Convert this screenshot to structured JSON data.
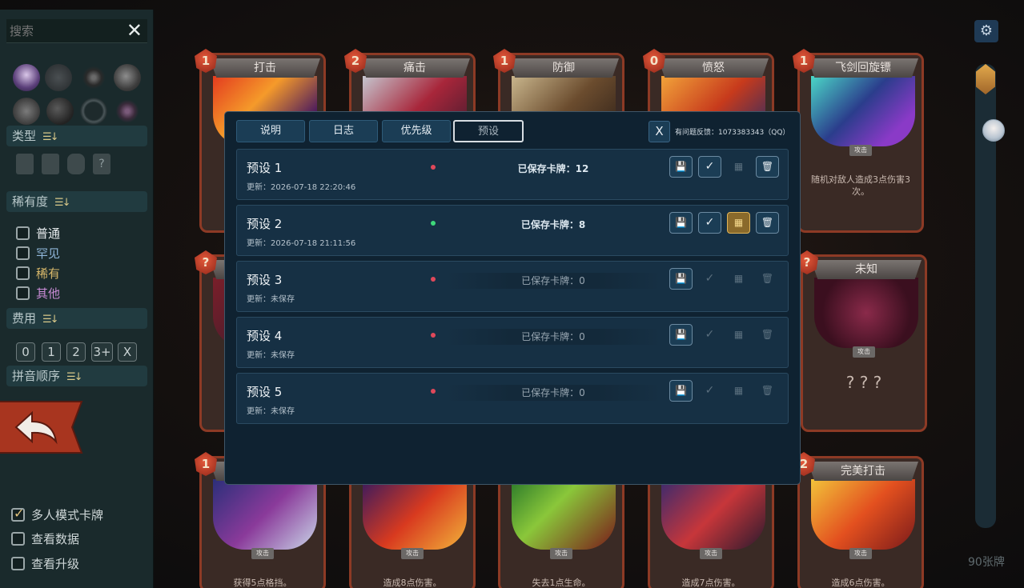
{
  "search": {
    "placeholder": "搜索",
    "close": "✕"
  },
  "filters": {
    "type_label": "类型",
    "type_icons": [
      "attack-card-type",
      "skill-card-type",
      "power-card-type",
      "unknown-card-type"
    ],
    "type_icon_glyphs": [
      "",
      "",
      "",
      "?"
    ],
    "rarity_label": "稀有度",
    "rarity_items": [
      {
        "label": "普通",
        "color": "#e8ecee"
      },
      {
        "label": "罕见",
        "color": "#8fb6d9"
      },
      {
        "label": "稀有",
        "color": "#d8b86a"
      },
      {
        "label": "其他",
        "color": "#c98cd6"
      }
    ],
    "cost_label": "费用",
    "cost_options": [
      "0",
      "1",
      "2",
      "3+",
      "X"
    ],
    "pinyin_label": "拼音顺序",
    "sort_glyph": "☰↓"
  },
  "bottom_options": [
    {
      "label": "多人模式卡牌",
      "checked": true
    },
    {
      "label": "查看数据",
      "checked": false
    },
    {
      "label": "查看升级",
      "checked": false
    }
  ],
  "settings_glyph": "⚙",
  "card_count": "90张牌",
  "cards": [
    {
      "name": "打击",
      "cost": "1",
      "type": "",
      "desc": ""
    },
    {
      "name": "痛击",
      "cost": "2",
      "type": "",
      "desc": ""
    },
    {
      "name": "防御",
      "cost": "1",
      "type": "",
      "desc": ""
    },
    {
      "name": "愤怒",
      "cost": "0",
      "type": "",
      "desc": ""
    },
    {
      "name": "飞剑回旋镖",
      "cost": "1",
      "type": "攻击",
      "desc": "随机对敌人造成3点伤害3次。"
    },
    {
      "name": "",
      "cost": "?",
      "type": "",
      "desc": ""
    },
    {
      "name": "未知",
      "cost": "?",
      "type": "攻击",
      "desc": "? ? ?"
    },
    {
      "name": "",
      "cost": "1",
      "type": "攻击",
      "desc": "获得5点格挡。"
    },
    {
      "name": "",
      "cost": "",
      "type": "攻击",
      "desc": "造成8点伤害。"
    },
    {
      "name": "",
      "cost": "",
      "type": "攻击",
      "desc": "失去1点生命。"
    },
    {
      "name": "",
      "cost": "",
      "type": "攻击",
      "desc": "造成7点伤害。"
    },
    {
      "name": "完美打击",
      "cost": "2",
      "type": "攻击",
      "desc": "造成6点伤害。"
    }
  ],
  "modal": {
    "tabs": [
      "说明",
      "日志",
      "优先级",
      "预设"
    ],
    "active_tab": "预设",
    "close": "X",
    "feedback": "有问题反馈：1073383343（QQ）",
    "presets": [
      {
        "name": "预设 1",
        "updated": "更新：2026-07-18 22:20:46",
        "saved": "已保存卡牌：12",
        "status_color": "#e0485a",
        "has_data": true,
        "active": false
      },
      {
        "name": "预设 2",
        "updated": "更新：2026-07-18 21:11:56",
        "saved": "已保存卡牌：8",
        "status_color": "#3ed87a",
        "has_data": true,
        "active": true
      },
      {
        "name": "预设 3",
        "updated": "更新：未保存",
        "saved": "已保存卡牌：0",
        "status_color": "#e0485a",
        "has_data": false,
        "active": false
      },
      {
        "name": "预设 4",
        "updated": "更新：未保存",
        "saved": "已保存卡牌：0",
        "status_color": "#e0485a",
        "has_data": false,
        "active": false
      },
      {
        "name": "预设 5",
        "updated": "更新：未保存",
        "saved": "已保存卡牌：0",
        "status_color": "#e0485a",
        "has_data": false,
        "active": false
      }
    ],
    "action_glyphs": {
      "save": "💾",
      "apply": "✓",
      "pin": "▦",
      "delete": "🗑"
    }
  }
}
